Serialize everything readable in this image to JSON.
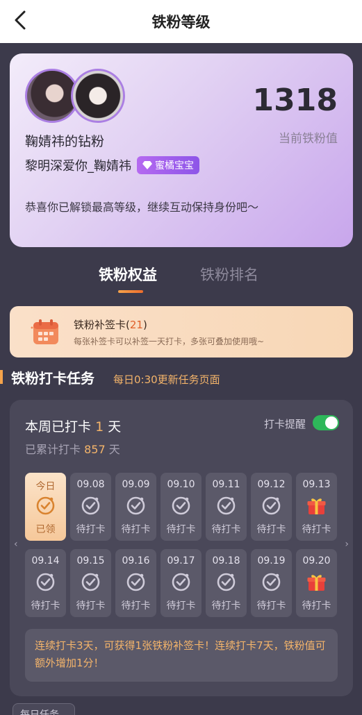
{
  "header": {
    "title": "铁粉等级"
  },
  "profile": {
    "score": "1318",
    "score_label": "当前铁粉值",
    "fan_name": "鞠婧祎的钻粉",
    "user_name": "黎明深爱你_鞠婧祎",
    "badge": "蜜橘宝宝",
    "congrats": "恭喜你已解锁最高等级，继续互动保持身份吧～"
  },
  "tabs": [
    {
      "label": "铁粉权益",
      "active": true
    },
    {
      "label": "铁粉排名",
      "active": false
    }
  ],
  "supplement": {
    "title": "铁粉补签卡",
    "count": "21",
    "description": "每张补签卡可以补签一天打卡，多张可叠加使用哦~"
  },
  "task": {
    "title": "铁粉打卡任务",
    "subtitle": "每日0:30更新任务页面"
  },
  "checkin": {
    "week_prefix": "本周已打卡",
    "week_count": "1",
    "week_unit": "天",
    "total_prefix": "已累计打卡",
    "total_count": "857",
    "total_unit": "天",
    "remind_label": "打卡提醒",
    "remind_on": true,
    "days": [
      {
        "date": "今日",
        "status": "已领",
        "icon": "check-icon",
        "today": true
      },
      {
        "date": "09.08",
        "status": "待打卡",
        "icon": "check-icon"
      },
      {
        "date": "09.09",
        "status": "待打卡",
        "icon": "check-icon"
      },
      {
        "date": "09.10",
        "status": "待打卡",
        "icon": "check-icon"
      },
      {
        "date": "09.11",
        "status": "待打卡",
        "icon": "check-icon"
      },
      {
        "date": "09.12",
        "status": "待打卡",
        "icon": "check-icon"
      },
      {
        "date": "09.13",
        "status": "待打卡",
        "icon": "gift-icon"
      },
      {
        "date": "09.14",
        "status": "待打卡",
        "icon": "check-icon"
      },
      {
        "date": "09.15",
        "status": "待打卡",
        "icon": "check-icon"
      },
      {
        "date": "09.16",
        "status": "待打卡",
        "icon": "check-icon"
      },
      {
        "date": "09.17",
        "status": "待打卡",
        "icon": "check-icon"
      },
      {
        "date": "09.18",
        "status": "待打卡",
        "icon": "check-icon"
      },
      {
        "date": "09.19",
        "status": "待打卡",
        "icon": "check-icon"
      },
      {
        "date": "09.20",
        "status": "待打卡",
        "icon": "gift-icon"
      }
    ],
    "note": "连续打卡3天，可获得1张铁粉补签卡！连续打卡7天，铁粉值可额外增加1分！"
  },
  "daily_tab": "每日任务",
  "colors": {
    "accent_orange": "#f4b46a",
    "background": "#3c3a4b",
    "toggle_on": "#2eb75a",
    "badge_purple": "#8d55e8"
  }
}
